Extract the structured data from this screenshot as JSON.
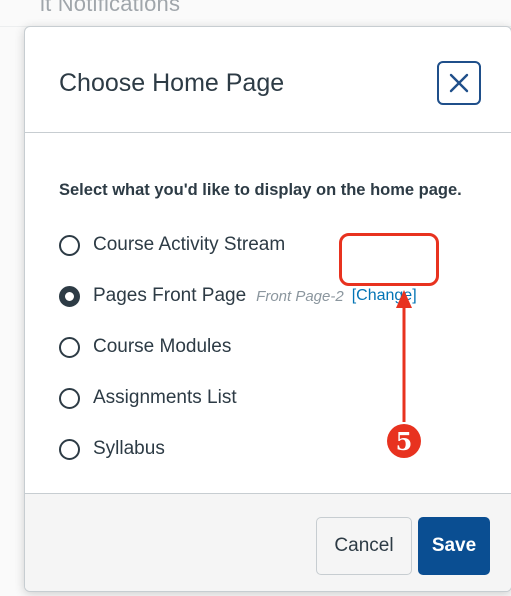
{
  "background": {
    "partial_heading": "it Notifications"
  },
  "dialog": {
    "title": "Choose Home Page",
    "close_label": "Close",
    "prompt": "Select what you'd like to display on the home page.",
    "options": [
      {
        "label": "Course Activity Stream",
        "checked": false
      },
      {
        "label": "Pages Front Page",
        "checked": true,
        "subtitle": "Front Page-2",
        "link": "[Change]"
      },
      {
        "label": "Course Modules",
        "checked": false
      },
      {
        "label": "Assignments List",
        "checked": false
      },
      {
        "label": "Syllabus",
        "checked": false
      }
    ],
    "footer": {
      "cancel_label": "Cancel",
      "save_label": "Save"
    }
  },
  "annotation": {
    "step_number": "5",
    "color": "#e8321f"
  },
  "colors": {
    "primary_button": "#0a4e92",
    "link": "#0374b5",
    "text": "#2d3b45"
  }
}
